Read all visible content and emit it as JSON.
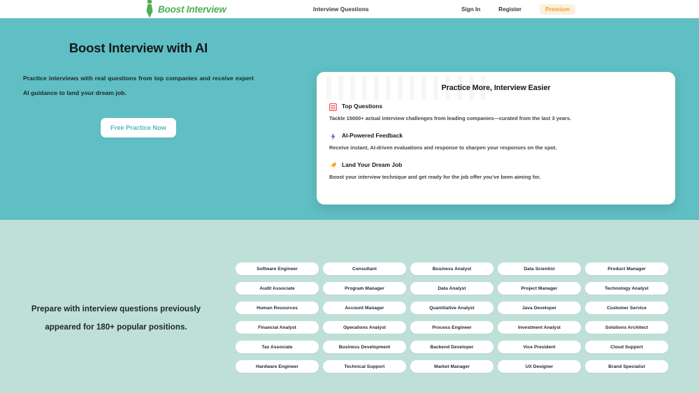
{
  "header": {
    "brand": "Boost Interview",
    "logo_icon": "necktie-icon",
    "nav_center": "Interview Questions",
    "sign_in": "Sign In",
    "register": "Register",
    "premium": "Premium",
    "premium_text_color": "#f0a030",
    "premium_bg_color": "#fdf0dc",
    "brand_color": "#4caf50",
    "border_color": "#63c2c6"
  },
  "hero": {
    "title": "Boost Interview with AI",
    "subtitle": "Practice interviews with real questions from top companies and receive expert AI guidance to land your dream job.",
    "cta_label": "Free Practice Now",
    "bg_color": "#5fbfc4",
    "cta_text_color": "#55b8bd"
  },
  "card": {
    "title": "Practice More, Interview Easier",
    "features": [
      {
        "icon": "list-table-icon",
        "icon_color": "#ef5350",
        "title": "Top Questions",
        "desc": "Tackle 15000+ actual interview challenges from leading companies—curated from the last 3 years."
      },
      {
        "icon": "lightning-bolt-icon",
        "icon_color": "#7c5cdb",
        "title": "AI-Powered Feedback",
        "desc": "Receive instant, AI-driven evaluations and response to sharpen your responses on the spot."
      },
      {
        "icon": "rocket-icon",
        "icon_color": "#f5a623",
        "title": "Land Your Dream Job",
        "desc": "Boost your interview technique and get ready for the job offer you've been aiming for."
      }
    ]
  },
  "positions": {
    "heading_line1": "Prepare with interview questions previously appeared",
    "heading_line2": "for 180+ popular positions.",
    "bg_color": "#bfe0d9",
    "chips": [
      "Software Engineer",
      "Consultant",
      "Business Analyst",
      "Data Scientist",
      "Product Manager",
      "Audit Associate",
      "Program Manager",
      "Data Analyst",
      "Project Manager",
      "Technology Analyst",
      "Human Resources",
      "Account Manager",
      "Quantitative Analyst",
      "Java Developer",
      "Customer Service",
      "Financial Analyst",
      "Operations Analyst",
      "Process Engineer",
      "Investment Analyst",
      "Solutions Architect",
      "Tax Associate",
      "Business Development",
      "Backend Developer",
      "Vice President",
      "Cloud Support",
      "Hardware Engineer",
      "Technical Support",
      "Market Manager",
      "UX Designer",
      "Brand Specialist"
    ]
  }
}
